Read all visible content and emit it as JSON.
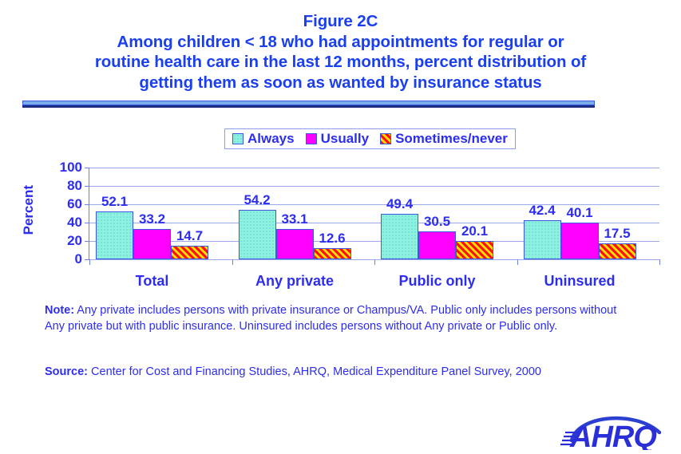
{
  "title": {
    "line1": "Figure 2C",
    "line2": "Among children < 18 who had appointments for regular or",
    "line3": "routine health care in the last 12 months, percent distribution of",
    "line4": "getting them as soon as wanted by insurance status"
  },
  "colors": {
    "text_blue": "#2d2df0",
    "title_blue": "#1a3ff0",
    "divider_light": "#7aaee8",
    "divider_dark": "#1b2f86",
    "gridline": "#9aa8ee",
    "always": "#8df0e0",
    "usually": "#ff00ff",
    "sometimes_base": "#ffe000",
    "sometimes_stripe": "#ff1111",
    "bar_border": "#3b56e0"
  },
  "legend": {
    "items": [
      {
        "label": "Always",
        "swatch": "fill-always"
      },
      {
        "label": "Usually",
        "swatch": "fill-usually"
      },
      {
        "label": "Sometimes/never",
        "swatch": "fill-sometimes"
      }
    ]
  },
  "chart_data": {
    "type": "bar",
    "title": "Among children < 18 who had appointments for regular or routine health care in the last 12 months, percent distribution of getting them as soon as wanted by insurance status",
    "xlabel": "",
    "ylabel": "Percent",
    "ylim": [
      0,
      100
    ],
    "yticks": [
      0,
      20,
      40,
      60,
      80,
      100
    ],
    "grid": true,
    "legend_position": "top-center",
    "categories": [
      "Total",
      "Any private",
      "Public only",
      "Uninsured"
    ],
    "series": [
      {
        "name": "Always",
        "values": [
          52.1,
          54.2,
          49.4,
          42.4
        ]
      },
      {
        "name": "Usually",
        "values": [
          33.2,
          33.1,
          30.5,
          40.1
        ]
      },
      {
        "name": "Sometimes/never",
        "values": [
          14.7,
          12.6,
          20.1,
          17.5
        ]
      }
    ],
    "value_labels": [
      [
        "52.1",
        "33.2",
        "14.7"
      ],
      [
        "54.2",
        "33.1",
        "12.6"
      ],
      [
        "49.4",
        "30.5",
        "20.1"
      ],
      [
        "42.4",
        "40.1",
        "17.5"
      ]
    ]
  },
  "note": {
    "prefix": "Note:",
    "text": " Any private includes persons with private insurance or Champus/VA.  Public only includes persons without Any private but with public insurance. Uninsured includes persons without Any private or Public only."
  },
  "source": {
    "prefix": "Source:",
    "text": " Center for Cost and Financing Studies, AHRQ, Medical Expenditure Panel Survey, 2000"
  },
  "logo": {
    "name": "ahrq-logo",
    "text": "AHRQ"
  }
}
